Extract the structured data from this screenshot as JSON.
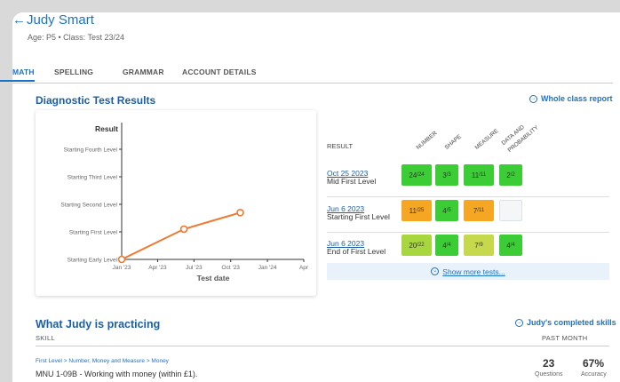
{
  "student": {
    "back_icon": "arrow-left-icon",
    "name": "Judy Smart",
    "meta": "Age: P5 • Class: Test 23/24"
  },
  "tabs": [
    "MATH",
    "SPELLING",
    "GRAMMAR",
    "ACCOUNT DETAILS"
  ],
  "diagnostic": {
    "title": "Diagnostic Test Results",
    "report_link": "Whole class report"
  },
  "chart_data": {
    "type": "line",
    "title": "Result",
    "xlabel": "Test date",
    "ylabel": "Result",
    "x_ticks": [
      "Jan '23",
      "Apr '23",
      "Jul '23",
      "Oct '23",
      "Jan '24",
      "Apr"
    ],
    "y_ticks": [
      "Starting Early Level",
      "Starting First Level",
      "Starting Second Level",
      "Starting Third Level",
      "Starting Fourth Level"
    ],
    "series": [
      {
        "x": [
          "2023-01-01",
          "2023-06-06",
          "2023-10-25"
        ],
        "y": [
          0,
          1.1,
          1.7
        ],
        "color": "#f07830"
      }
    ]
  },
  "tests": {
    "result_label": "RESULT",
    "columns": [
      "NUMBER",
      "SHAPE",
      "MEASURE",
      "DATA AND",
      "PROBABILITY"
    ],
    "rows": [
      {
        "date": "Oct 25 2023",
        "level": "Mid First Level",
        "cells": [
          {
            "v": "24",
            "d": "/24",
            "c": "#3ccc35"
          },
          {
            "v": "3",
            "d": "/3",
            "c": "#3ccc35"
          },
          {
            "v": "11",
            "d": "/11",
            "c": "#3ccc35"
          },
          {
            "v": "2",
            "d": "/2",
            "c": "#3ccc35"
          }
        ]
      },
      {
        "date": "Jun 6 2023",
        "level": "Starting First Level",
        "cells": [
          {
            "v": "11",
            "d": "/25",
            "c": "#f5a623"
          },
          {
            "v": "4",
            "d": "/5",
            "c": "#3ccc35"
          },
          {
            "v": "7",
            "d": "/11",
            "c": "#f5a623"
          },
          {
            "v": "",
            "d": "",
            "c": "#f4f6f8"
          }
        ]
      },
      {
        "date": "Jun 6 2023",
        "level": "End of First Level",
        "cells": [
          {
            "v": "20",
            "d": "/22",
            "c": "#a8d63e"
          },
          {
            "v": "4",
            "d": "/4",
            "c": "#3ccc35"
          },
          {
            "v": "7",
            "d": "/9",
            "c": "#c6d94c"
          },
          {
            "v": "4",
            "d": "/4",
            "c": "#3ccc35"
          }
        ]
      }
    ],
    "show_more": "Show more tests..."
  },
  "practicing": {
    "title": "What Judy is practicing",
    "completed_link": "Judy's completed skills",
    "skill_header": "SKILL",
    "period_header": "PAST MONTH",
    "item": {
      "path": "First Level > Number, Money and Measure > Money",
      "name": "MNU 1-09B - Working with money (within £1).",
      "questions": "23",
      "questions_label": "Questions",
      "accuracy": "67%",
      "accuracy_label": "Accuracy"
    }
  }
}
